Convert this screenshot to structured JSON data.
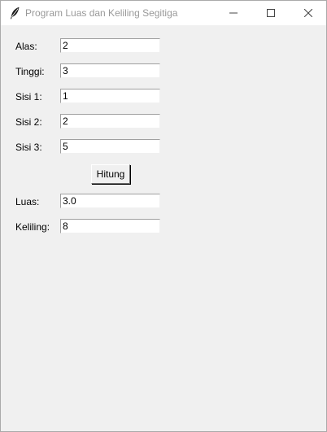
{
  "window": {
    "title": "Program Luas dan Keliling Segitiga",
    "icon": "feather-icon",
    "controls": [
      "minimize-icon",
      "maximize-icon",
      "close-icon"
    ]
  },
  "form": {
    "alas": {
      "label": "Alas:",
      "value": "2"
    },
    "tinggi": {
      "label": "Tinggi:",
      "value": "3"
    },
    "sisi1": {
      "label": "Sisi 1:",
      "value": "1"
    },
    "sisi2": {
      "label": "Sisi 2:",
      "value": "2"
    },
    "sisi3": {
      "label": "Sisi 3:",
      "value": "5"
    },
    "hitung_label": "Hitung",
    "luas": {
      "label": "Luas:",
      "value": "3.0"
    },
    "keliling": {
      "label": "Keliling:",
      "value": "8"
    }
  },
  "colors": {
    "window_bg": "#f0f0f0",
    "titlebar_bg": "#ffffff",
    "title_text": "#999999"
  }
}
